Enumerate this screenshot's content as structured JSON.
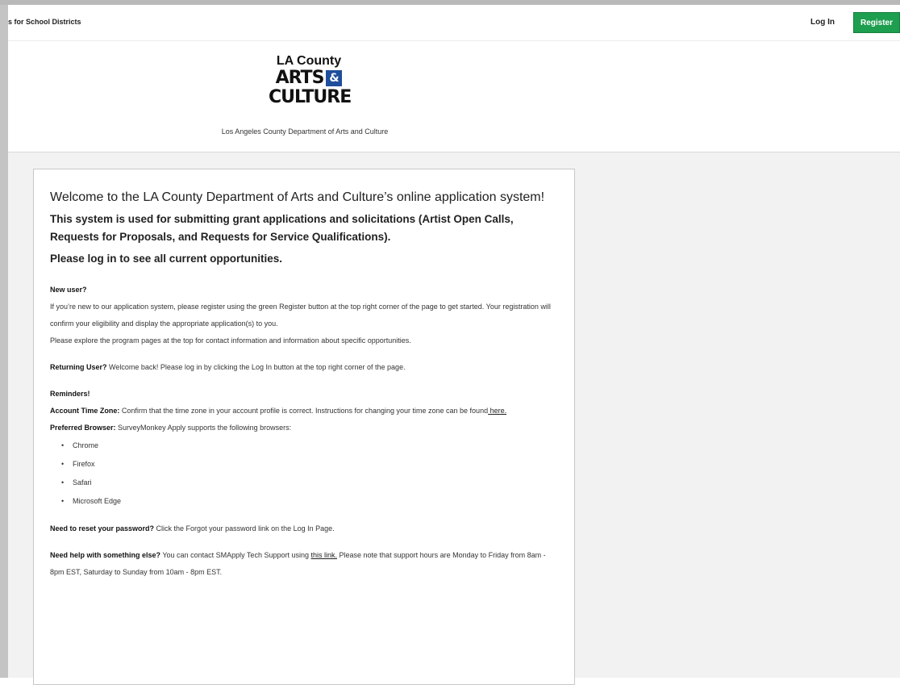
{
  "topbar": {
    "nav_left": "s for School Districts",
    "login_label": "Log In",
    "register_label": "Register"
  },
  "header": {
    "logo_line1": "LA County",
    "logo_line2": "ARTS",
    "logo_amp": "&",
    "logo_line3": "CULTURE",
    "dept_name": "Los Angeles County Department of Arts and Culture"
  },
  "main": {
    "welcome": "Welcome to the LA County Department of Arts and Culture’s online application system!",
    "intro": "This system is used for submitting grant applications and solicitations (Artist Open Calls, Requests for Proposals, and Requests for Service Qualifications).",
    "login_prompt": "Please log in to see all current opportunities.",
    "new_user_heading": "New user?",
    "new_user_text": "If you’re new to our application system, please register using the green Register button at the top right corner of the page to get started. Your registration will confirm your eligibility and display the appropriate application(s) to you.",
    "explore_text": "Please explore the program pages at the top for contact information and information about specific opportunities.",
    "returning_label": "Returning User?",
    "returning_text": " Welcome back! Please log in by clicking the Log In button at the top right corner of the page.",
    "reminders_heading": "Reminders!",
    "timezone_label": "Account Time Zone:",
    "timezone_text": " Confirm that the time zone in your account profile is correct. Instructions for changing your time zone can be found",
    "timezone_link": " here.",
    "browser_label": "Preferred Browser:",
    "browser_text": " SurveyMonkey Apply supports the following browsers:",
    "browsers": [
      "Chrome",
      "Firefox",
      "Safari",
      "Microsoft Edge"
    ],
    "reset_label": "Need to reset your password?",
    "reset_text": " Click the Forgot your password link on the Log In Page.",
    "help_label": "Need help with something else?",
    "help_text1": " You can contact SMApply Tech Support using ",
    "help_link": "this link.",
    "help_text2": " Please note that support hours are Monday to Friday from 8am - 8pm EST, Saturday to Sunday from 10am - 8pm EST."
  },
  "colors": {
    "register_bg": "#1e9e4f",
    "logo_amp_bg": "#1f4e9c",
    "annotation_arrow": "#b00000"
  },
  "icons": {
    "annotation": "red-arrow-icon"
  }
}
